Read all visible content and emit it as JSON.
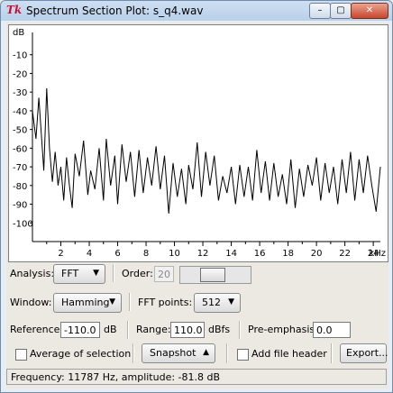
{
  "window": {
    "title": "Spectrum Section Plot: s_q4.wav",
    "app_icon": "Tk",
    "controls": {
      "minimize": "–",
      "maximize": "▢",
      "close": "✕"
    }
  },
  "plot": {
    "y_unit": "dB",
    "y_ticks": [
      "-10",
      "-20",
      "-30",
      "-40",
      "-50",
      "-60",
      "-70",
      "-80",
      "-90",
      "-100"
    ],
    "x_ticks": [
      "2",
      "4",
      "6",
      "8",
      "10",
      "12",
      "14",
      "16",
      "18",
      "20",
      "22",
      "24"
    ],
    "x_end_label": "kHz"
  },
  "chart_data": {
    "type": "line",
    "ylabel": "dB",
    "ylim": [
      -110,
      0
    ],
    "xlim": [
      0,
      24.5
    ],
    "grid": false,
    "series": [
      {
        "values": [
          [
            0,
            -40
          ],
          [
            0.25,
            -55
          ],
          [
            0.45,
            -33
          ],
          [
            0.6,
            -50
          ],
          [
            0.8,
            -72
          ],
          [
            1.0,
            -28
          ],
          [
            1.2,
            -60
          ],
          [
            1.4,
            -78
          ],
          [
            1.6,
            -62
          ],
          [
            1.8,
            -80
          ],
          [
            2.0,
            -70
          ],
          [
            2.2,
            -88
          ],
          [
            2.4,
            -65
          ],
          [
            2.6,
            -80
          ],
          [
            2.8,
            -92
          ],
          [
            3.0,
            -63
          ],
          [
            3.3,
            -75
          ],
          [
            3.6,
            -56
          ],
          [
            3.9,
            -85
          ],
          [
            4.1,
            -72
          ],
          [
            4.4,
            -82
          ],
          [
            4.7,
            -60
          ],
          [
            5.0,
            -88
          ],
          [
            5.2,
            -55
          ],
          [
            5.5,
            -80
          ],
          [
            5.8,
            -64
          ],
          [
            6.0,
            -90
          ],
          [
            6.3,
            -58
          ],
          [
            6.6,
            -78
          ],
          [
            6.9,
            -62
          ],
          [
            7.2,
            -86
          ],
          [
            7.5,
            -61
          ],
          [
            7.8,
            -84
          ],
          [
            8.1,
            -65
          ],
          [
            8.4,
            -80
          ],
          [
            8.7,
            -59
          ],
          [
            9.0,
            -82
          ],
          [
            9.3,
            -64
          ],
          [
            9.6,
            -95
          ],
          [
            9.9,
            -68
          ],
          [
            10.2,
            -86
          ],
          [
            10.5,
            -71
          ],
          [
            10.8,
            -90
          ],
          [
            11.0,
            -69
          ],
          [
            11.3,
            -82
          ],
          [
            11.6,
            -57
          ],
          [
            11.9,
            -86
          ],
          [
            12.2,
            -62
          ],
          [
            12.5,
            -80
          ],
          [
            12.8,
            -64
          ],
          [
            13.1,
            -88
          ],
          [
            13.4,
            -75
          ],
          [
            13.7,
            -84
          ],
          [
            14.0,
            -70
          ],
          [
            14.3,
            -90
          ],
          [
            14.6,
            -69
          ],
          [
            14.9,
            -86
          ],
          [
            15.2,
            -70
          ],
          [
            15.5,
            -88
          ],
          [
            15.8,
            -61
          ],
          [
            16.1,
            -84
          ],
          [
            16.4,
            -67
          ],
          [
            16.7,
            -88
          ],
          [
            17.0,
            -68
          ],
          [
            17.3,
            -86
          ],
          [
            17.6,
            -74
          ],
          [
            17.9,
            -90
          ],
          [
            18.2,
            -66
          ],
          [
            18.5,
            -92
          ],
          [
            18.8,
            -71
          ],
          [
            19.1,
            -86
          ],
          [
            19.4,
            -69
          ],
          [
            19.7,
            -80
          ],
          [
            20.0,
            -65
          ],
          [
            20.3,
            -88
          ],
          [
            20.6,
            -68
          ],
          [
            20.9,
            -84
          ],
          [
            21.2,
            -70
          ],
          [
            21.5,
            -90
          ],
          [
            21.8,
            -66
          ],
          [
            22.1,
            -84
          ],
          [
            22.4,
            -62
          ],
          [
            22.7,
            -88
          ],
          [
            23.0,
            -66
          ],
          [
            23.3,
            -84
          ],
          [
            23.6,
            -64
          ],
          [
            23.9,
            -80
          ],
          [
            24.2,
            -94
          ],
          [
            24.5,
            -70
          ]
        ]
      }
    ]
  },
  "controls": {
    "analysis_label": "Analysis:",
    "analysis_value": "FFT",
    "order_label": "Order:",
    "order_value": "20",
    "window_label": "Window:",
    "window_value": "Hamming",
    "fft_points_label": "FFT points:",
    "fft_points_value": "512",
    "reference_label": "Reference:",
    "reference_value": "-110.0",
    "reference_unit": "dB",
    "range_label": "Range:",
    "range_value": "110.0",
    "range_unit": "dBfs",
    "preemphasis_label": "Pre-emphasis:",
    "preemphasis_value": "0.0",
    "average_label": "Average of selection",
    "snapshot_label": "Snapshot",
    "add_header_label": "Add file header",
    "export_label": "Export..."
  },
  "status": {
    "text": "Frequency: 11787 Hz, amplitude: -81.8 dB"
  }
}
